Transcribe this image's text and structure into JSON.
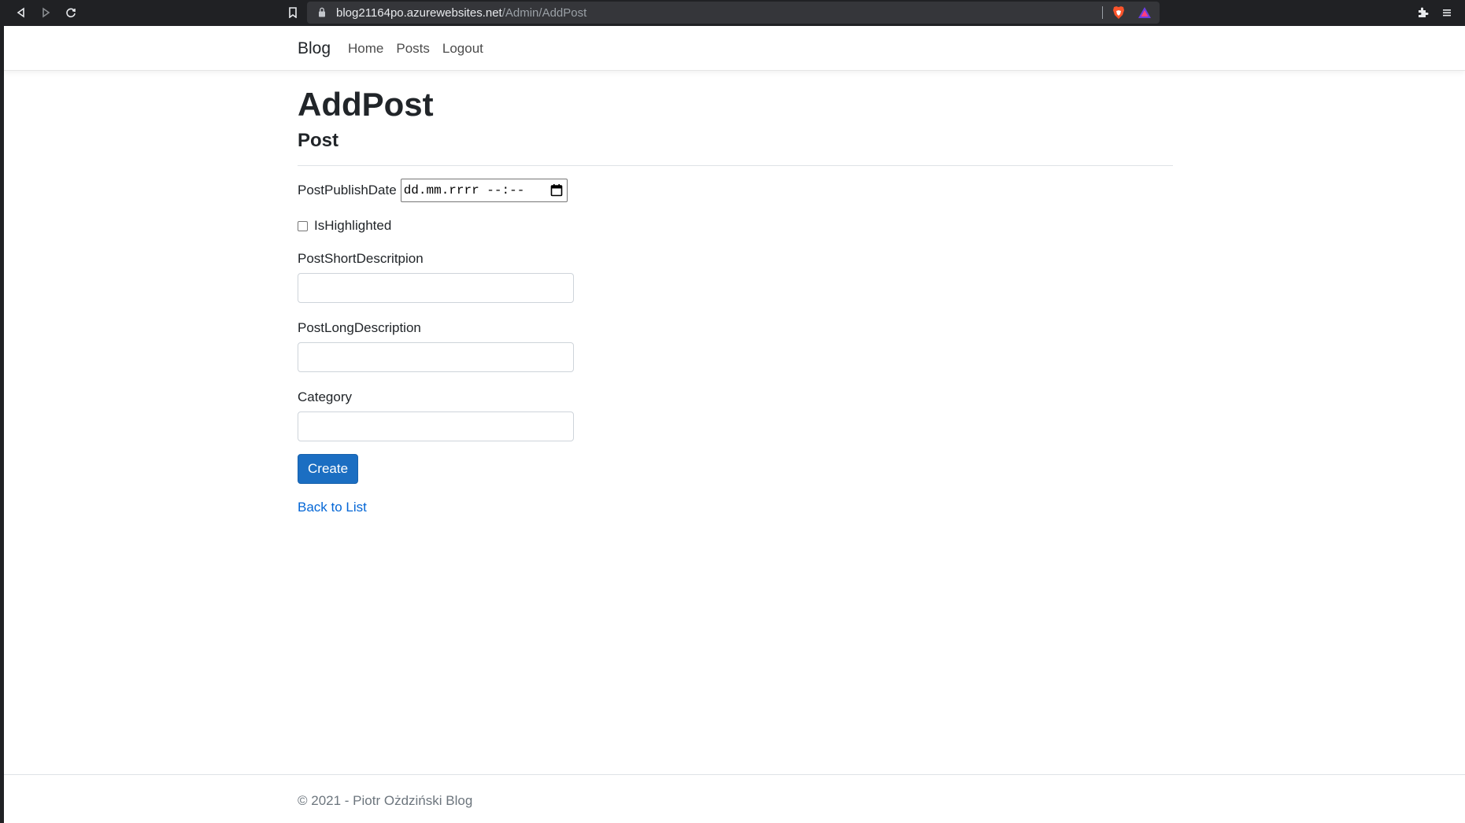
{
  "browser": {
    "url_host": "blog21164po.azurewebsites.net",
    "url_path": "/Admin/AddPost",
    "icons": {
      "back": "back-arrow-icon",
      "forward": "forward-arrow-icon",
      "reload": "reload-icon",
      "bookmark": "bookmark-icon",
      "lock": "lock-icon",
      "brave": "brave-shield-icon",
      "rewards": "brave-rewards-icon",
      "extensions": "extensions-icon",
      "menu": "menu-icon"
    },
    "colors": {
      "brave": "#fb542b",
      "rewards": "#a0a5eb"
    }
  },
  "navbar": {
    "brand": "Blog",
    "links": [
      {
        "label": "Home"
      },
      {
        "label": "Posts"
      },
      {
        "label": "Logout"
      }
    ]
  },
  "main": {
    "title": "AddPost",
    "subtitle": "Post",
    "fields": {
      "publish_date": {
        "label": "PostPublishDate",
        "placeholder": "dd.mm.rrrr --:--"
      },
      "highlighted": {
        "label": "IsHighlighted",
        "checked": false
      },
      "short_description": {
        "label": "PostShortDescritpion",
        "value": ""
      },
      "long_description": {
        "label": "PostLongDescription",
        "value": ""
      },
      "category": {
        "label": "Category",
        "value": ""
      }
    },
    "create_button": "Create",
    "back_link": "Back to List",
    "colors": {
      "primary": "#1b6ec2",
      "link": "#0366d6"
    }
  },
  "footer": {
    "text": "© 2021 - Piotr Ożdziński Blog"
  }
}
